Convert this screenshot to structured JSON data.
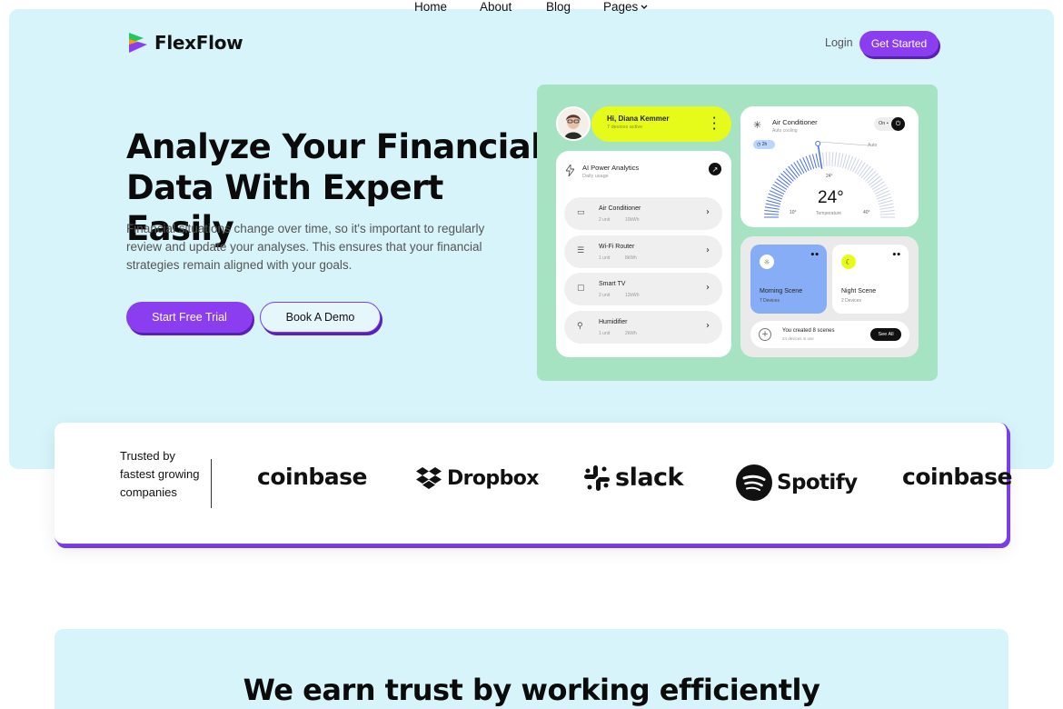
{
  "brand": {
    "name": "FlexFlow"
  },
  "nav": {
    "items": [
      "Home",
      "About",
      "Blog",
      "Pages"
    ],
    "login": "Login",
    "cta": "Get Started"
  },
  "hero": {
    "title_line1": "Analyze Your Financial",
    "title_line2": "Data With Expert Easily",
    "description": "Financial situations change over time, so it's important to regularly review and update your analyses. This ensures that your financial strategies remain aligned with your goals.",
    "primary_cta": "Start Free Trial",
    "secondary_cta": "Book A Demo"
  },
  "dashboard": {
    "user": {
      "greeting": "Hi, Diana Kemmer",
      "sub": "7 devices active"
    },
    "analytics": {
      "title": "AI Power Analytics",
      "sub": "Daily usage",
      "devices": [
        {
          "name": "Air Conditioner",
          "units": "2 unit",
          "usage": "10kWh",
          "icon": "ac-icon"
        },
        {
          "name": "Wi-Fi Router",
          "units": "1 unit",
          "usage": "8kWh",
          "icon": "router-icon"
        },
        {
          "name": "Smart TV",
          "units": "2 unit",
          "usage": "12kWh",
          "icon": "tv-icon"
        },
        {
          "name": "Humidifier",
          "units": "1 unit",
          "usage": "2kWh",
          "icon": "humidifier-icon"
        }
      ]
    },
    "ac": {
      "title": "Air Conditioner",
      "sub": "Auto cooling",
      "toggle": "On",
      "badge": "2h",
      "temp": "24°",
      "temp_small": "24°",
      "temp_label": "Temperature",
      "min": "10°",
      "max": "40°",
      "auto": "Auto",
      "level_fraction": 0.45
    },
    "scenes": {
      "morning": {
        "name": "Morning Scene",
        "sub": "7 Devices"
      },
      "night": {
        "name": "Night Scene",
        "sub": "2 Devices"
      },
      "summary": {
        "title": "You created 8 scenes",
        "sub": "24 devices in use",
        "button": "See All"
      }
    },
    "colors": {
      "panel": "#a5e3c3",
      "accent_yellow": "#e6fb1a",
      "morning_blue": "#88adf7",
      "gauge_blue": "#4a6ff0"
    }
  },
  "trust": {
    "text": "Trusted by fastest growing companies",
    "logos": [
      "coinbase",
      "Dropbox",
      "slack",
      "Spotify",
      "coinbase"
    ]
  },
  "section2": {
    "title": "We earn trust by working efficiently"
  },
  "colors": {
    "primary": "#8a3ef0",
    "hero_bg": "#d6f4f9"
  }
}
